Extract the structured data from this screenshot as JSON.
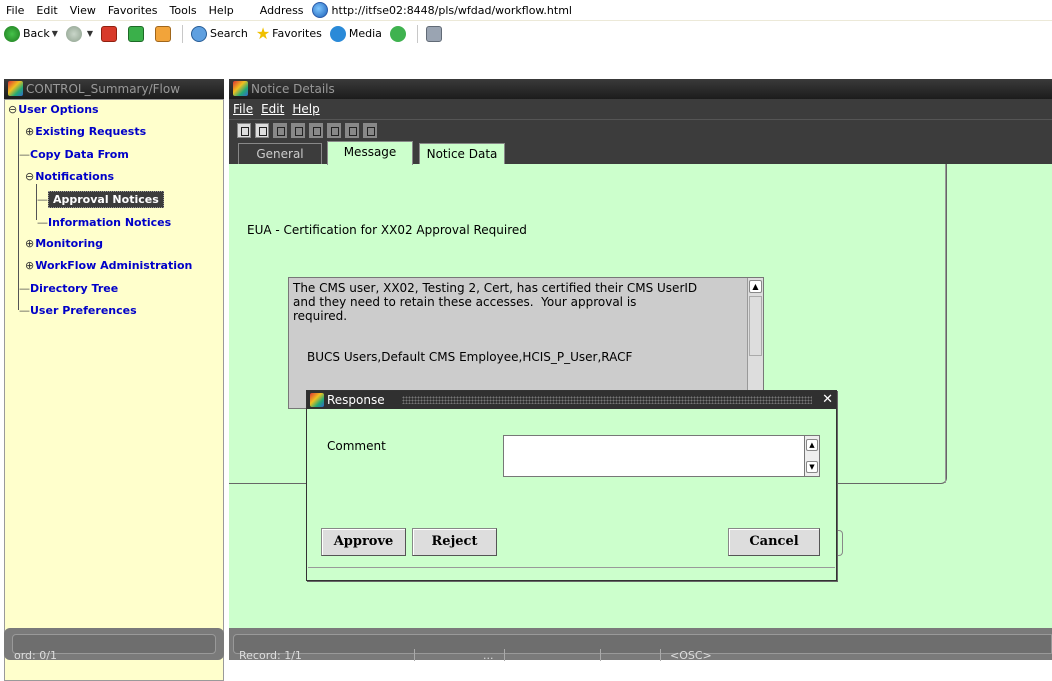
{
  "browser": {
    "menus": [
      "File",
      "Edit",
      "View",
      "Favorites",
      "Tools",
      "Help"
    ],
    "address_label": "Address",
    "address_url": "http://itfse02:8448/pls/wfdad/workflow.html",
    "toolbar": {
      "back": "Back",
      "search": "Search",
      "favorites": "Favorites",
      "media": "Media"
    }
  },
  "left_window": {
    "title": "CONTROL_Summary/Flow",
    "tree": {
      "root": "User Options",
      "existing_requests": "Existing Requests",
      "copy_data_from": "Copy Data From",
      "notifications": "Notifications",
      "approval_notices": "Approval Notices",
      "information_notices": "Information Notices",
      "monitoring": "Monitoring",
      "workflow_admin": "WorkFlow Administration",
      "directory_tree": "Directory Tree",
      "user_preferences": "User Preferences"
    },
    "status": "ord: 0/1"
  },
  "right_window": {
    "title": "Notice Details",
    "menus": {
      "file": "File",
      "edit": "Edit",
      "help": "Help"
    },
    "tabs": {
      "general": "General",
      "message": "Message",
      "notice_data": "Notice Data"
    },
    "subject": "EUA - Certification for XX02 Approval Required",
    "message_body": "The CMS user, XX02, Testing 2, Cert, has certified their CMS UserID\nand they need to retain these accesses.  Your approval is\nrequired.",
    "message_roles": "BUCS Users,Default CMS Employee,HCIS_P_User,RACF",
    "status": {
      "record": "Record: 1/1",
      "ellipsis": "...",
      "osc": "<OSC>"
    }
  },
  "dialog": {
    "title": "Response",
    "close": "✕",
    "comment_label": "Comment",
    "comment_value": "",
    "approve": "Approve",
    "reject": "Reject",
    "cancel": "Cancel"
  }
}
